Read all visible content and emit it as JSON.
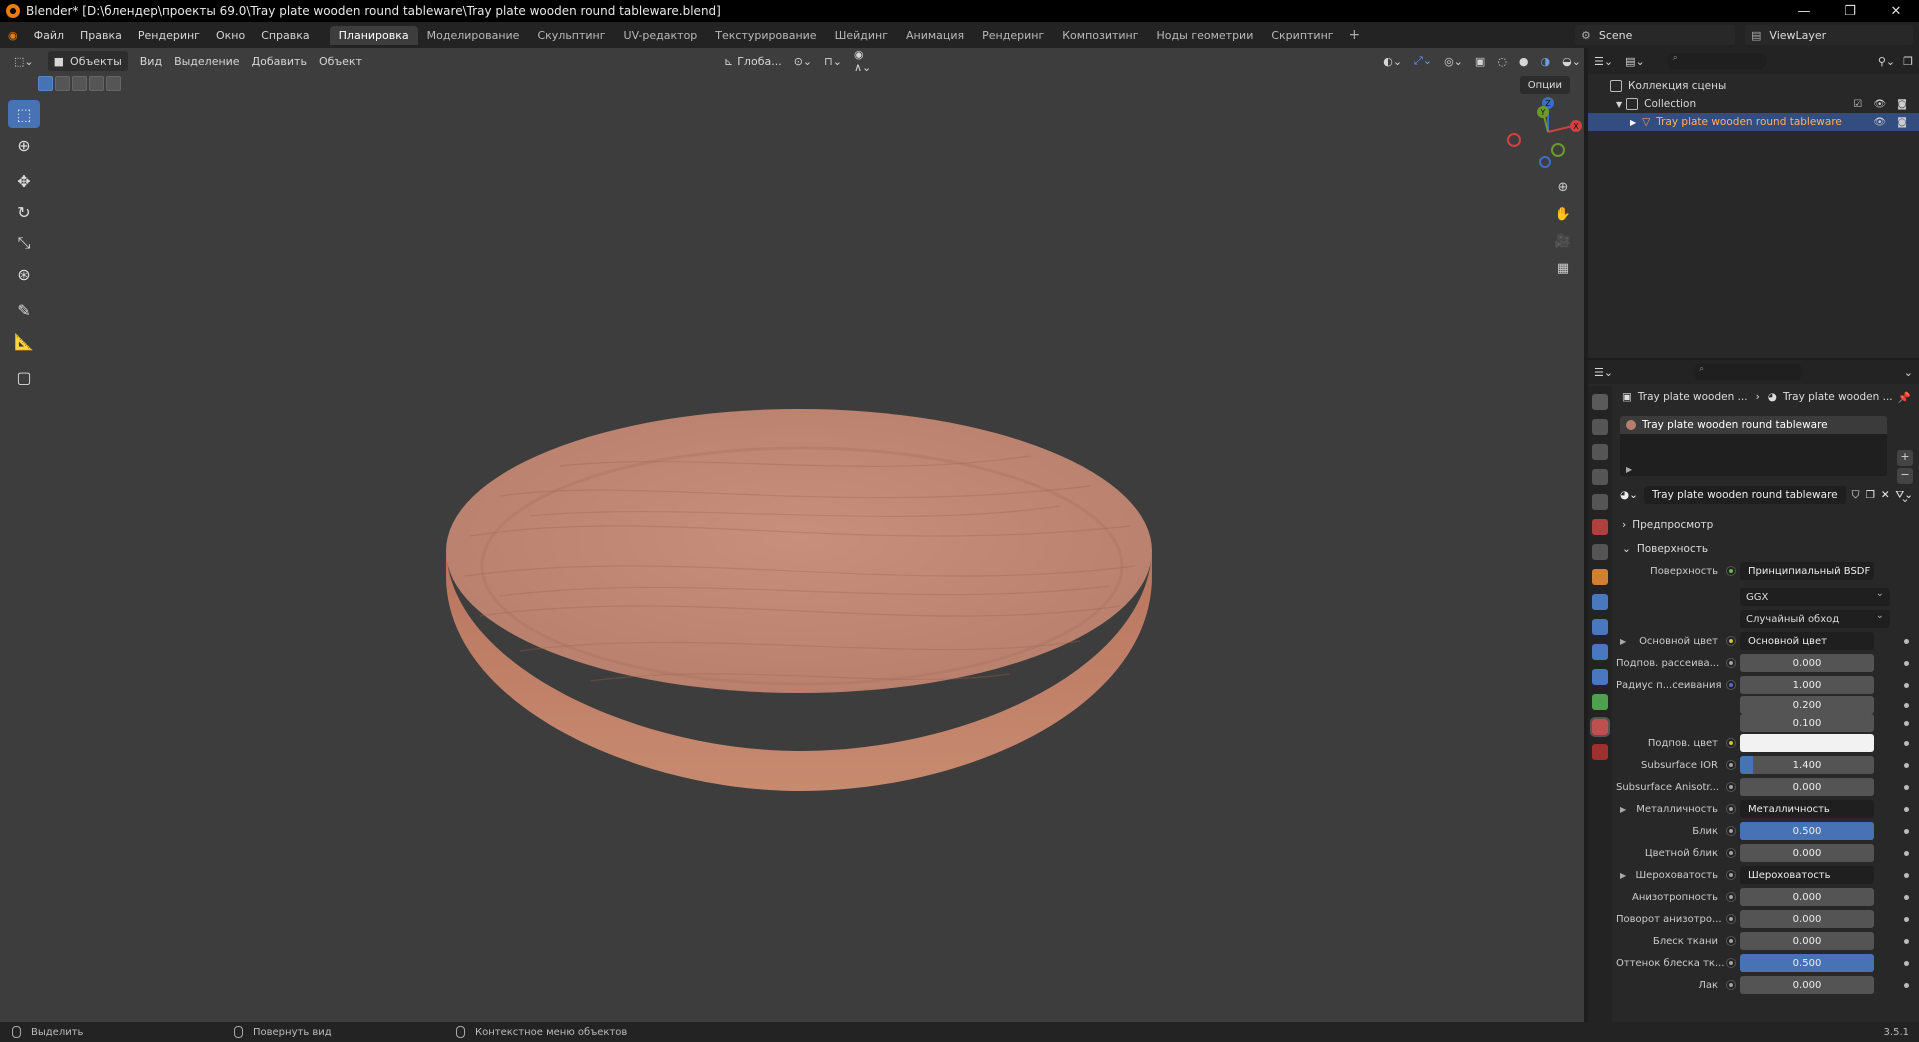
{
  "titlebar": {
    "title": "Blender* [D:\\блендер\\проекты 69.0\\Tray plate wooden round tableware\\Tray plate wooden round tableware.blend]",
    "minimize": "—",
    "maximize": "❐",
    "close": "✕"
  },
  "menu": [
    "Файл",
    "Правка",
    "Рендеринг",
    "Окно",
    "Справка"
  ],
  "workspaces": [
    "Планировка",
    "Моделирование",
    "Скульптинг",
    "UV-редактор",
    "Текстурирование",
    "Шейдинг",
    "Анимация",
    "Рендеринг",
    "Композитинг",
    "Ноды геометрии",
    "Скриптинг"
  ],
  "workspace_plus": "+",
  "scene": {
    "name": "Scene",
    "view_layer": "ViewLayer"
  },
  "viewport": {
    "mode": "Объекты",
    "menu": [
      "Вид",
      "Выделение",
      "Добавить",
      "Объект"
    ],
    "transform_orientation": "Глоба...",
    "options": "Опции",
    "gizmo_axes": {
      "x": "X",
      "y": "Y",
      "z": "Z"
    },
    "plate_color": "#c98a76"
  },
  "outliner": {
    "scene_collection": "Коллекция сцены",
    "collection": "Collection",
    "object": "Tray plate wooden round tableware"
  },
  "properties": {
    "breadcrumb_object": "Tray plate wooden ...",
    "breadcrumb_material": "Tray plate wooden ...",
    "slot": "Tray plate wooden round tableware",
    "material_name": "Tray plate wooden round tableware",
    "sections": {
      "preview": "Предпросмотр",
      "surface": "Поверхность"
    },
    "surface_label": "Поверхность",
    "surface_shader": "Принципиальный BSDF",
    "distribution": "GGX",
    "subsurface_method": "Случайный обход",
    "rows": [
      {
        "label": "Основной цвет",
        "value": "Основной цвет",
        "kind": "link",
        "dot": "y",
        "expand": true
      },
      {
        "label": "Подпов. рассеива...",
        "value": "0.000",
        "kind": "num",
        "dot": "gray"
      },
      {
        "label": "Радиус п...сеивания",
        "value": "1.000",
        "kind": "num",
        "dot": "b"
      },
      {
        "label": "",
        "value": "0.200",
        "kind": "sub"
      },
      {
        "label": "",
        "value": "0.100",
        "kind": "sub"
      },
      {
        "label": "Подпов. цвет",
        "value": "",
        "kind": "color",
        "dot": "y"
      },
      {
        "label": "Subsurface IOR",
        "value": "1.400",
        "kind": "num",
        "dot": "gray",
        "fill": 0.1
      },
      {
        "label": "Subsurface Anisotr...",
        "value": "0.000",
        "kind": "num",
        "dot": "gray"
      },
      {
        "label": "Металличность",
        "value": "Металличность",
        "kind": "link",
        "dot": "gray",
        "expand": true
      },
      {
        "label": "Блик",
        "value": "0.500",
        "kind": "num",
        "dot": "gray",
        "fill": 1.0
      },
      {
        "label": "Цветной блик",
        "value": "0.000",
        "kind": "num",
        "dot": "gray"
      },
      {
        "label": "Шероховатость",
        "value": "Шероховатость",
        "kind": "link",
        "dot": "gray",
        "expand": true
      },
      {
        "label": "Анизотропность",
        "value": "0.000",
        "kind": "num",
        "dot": "gray"
      },
      {
        "label": "Поворот анизотро...",
        "value": "0.000",
        "kind": "num",
        "dot": "gray"
      },
      {
        "label": "Блеск ткани",
        "value": "0.000",
        "kind": "num",
        "dot": "gray"
      },
      {
        "label": "Оттенок блеска тк...",
        "value": "0.500",
        "kind": "num",
        "dot": "gray",
        "fill": 1.0
      },
      {
        "label": "Лак",
        "value": "0.000",
        "kind": "num",
        "dot": "gray"
      }
    ]
  },
  "statusbar": {
    "select": "Выделить",
    "rotate": "Повернуть вид",
    "context": "Контекстное меню объектов",
    "version": "3.5.1"
  }
}
